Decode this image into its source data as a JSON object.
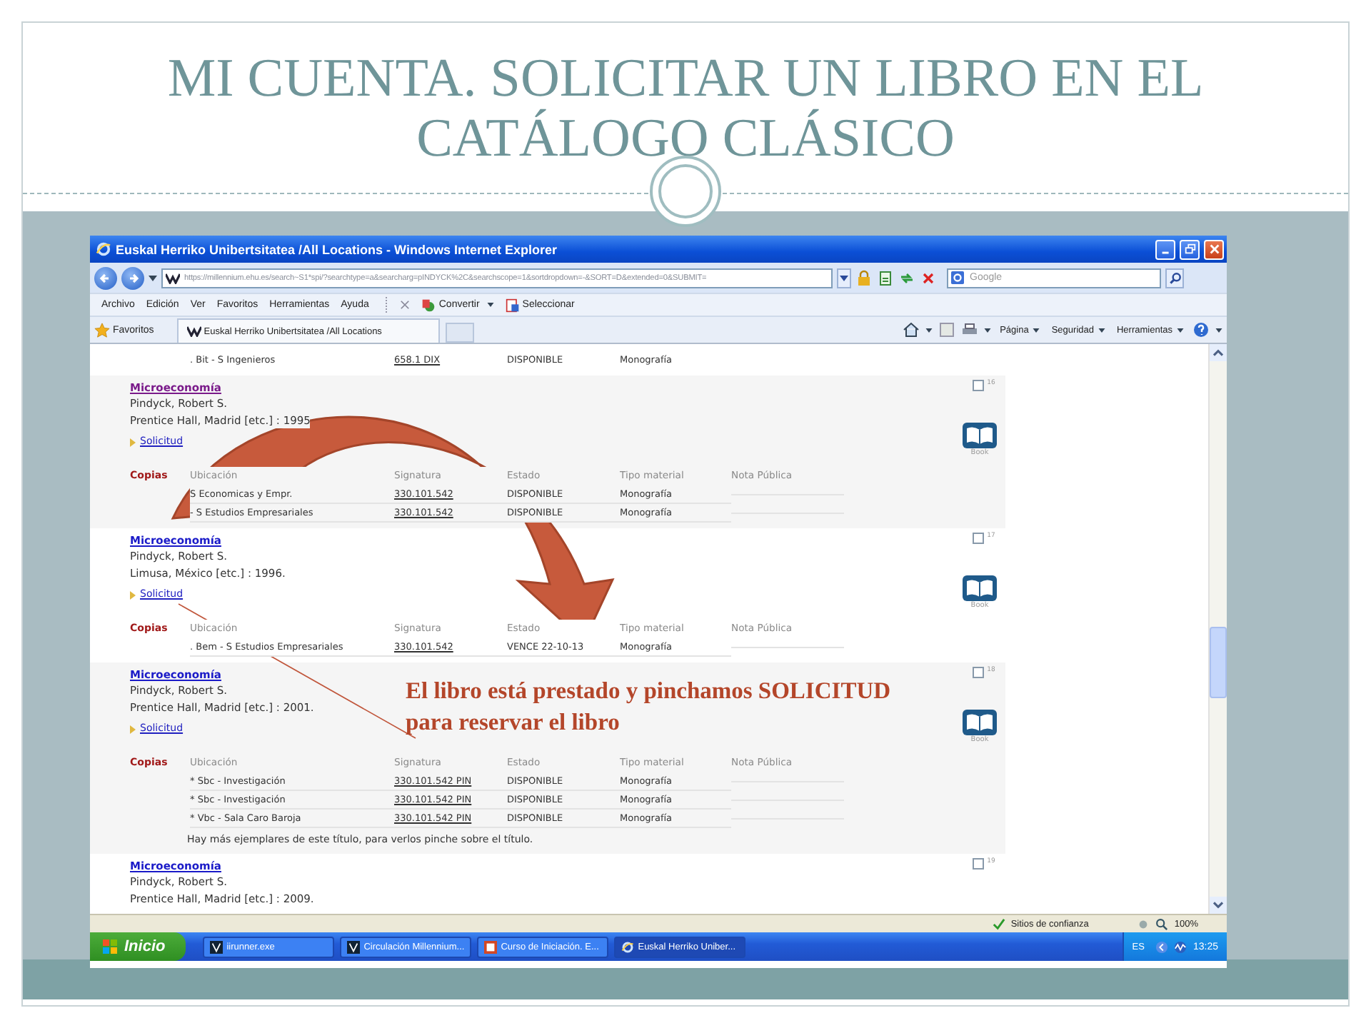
{
  "slide": {
    "title": "MI CUENTA. SOLICITAR UN LIBRO EN EL CATÁLOGO CLÁSICO"
  },
  "browser": {
    "title": "Euskal Herriko Unibertsitatea /All Locations - Windows Internet Explorer",
    "address": "https://millennium.ehu.es/search~S1*spi/?searchtype=a&searcharg=pINDYCK%2C&searchscope=1&sortdropdown=-&SORT=D&extended=0&SUBMIT=",
    "search_placeholder": "Google",
    "menu": [
      "Archivo",
      "Edición",
      "Ver",
      "Favoritos",
      "Herramientas",
      "Ayuda"
    ],
    "toolbar": [
      {
        "label": "Convertir",
        "kind": "convert"
      },
      {
        "label": "Seleccionar",
        "kind": "select"
      }
    ],
    "favorites": "Favoritos",
    "tabs": [
      {
        "label": "Euskal Herriko Unibertsitatea /All Locations",
        "selected": true
      }
    ],
    "commands": [
      "Página",
      "Seguridad",
      "Herramientas"
    ],
    "status": {
      "zone": "Sitios de confianza",
      "zoom": "100%"
    }
  },
  "page": {
    "top_row": {
      "location": ". Bit - S Ingenieros",
      "call_number": "658.1 DIX",
      "status": "DISPONIBLE",
      "material": "Monografía"
    },
    "records": [
      {
        "number": "16",
        "checked": false,
        "title": "Microeconomía",
        "visited": true,
        "author": "Pindyck, Robert S.",
        "publisher": "Prentice Hall, Madrid [etc.] : 1995",
        "request_link": "Solicitud",
        "material_label": "Book",
        "copies": {
          "label": "Copias",
          "columns": [
            "Ubicación",
            "Signatura",
            "Estado",
            "Tipo material",
            "Nota Pública"
          ],
          "rows": [
            {
              "location": "S Economicas y Empr.",
              "call_number": "330.101.542",
              "status": "DISPONIBLE",
              "material": "Monografía"
            },
            {
              "location": "- S Estudios Empresariales",
              "call_number": "330.101.542",
              "status": "DISPONIBLE",
              "material": "Monografía"
            }
          ]
        }
      },
      {
        "number": "17",
        "checked": false,
        "title": "Microeconomía",
        "visited": false,
        "author": "Pindyck, Robert S.",
        "publisher": "Limusa, México [etc.] : 1996.",
        "request_link": "Solicitud",
        "material_label": "Book",
        "copies": {
          "label": "Copias",
          "columns": [
            "Ubicación",
            "Signatura",
            "Estado",
            "Tipo material",
            "Nota Pública"
          ],
          "rows": [
            {
              "location": ". Bem - S Estudios Empresariales",
              "call_number": "330.101.542",
              "status": "VENCE 22-10-13",
              "material": "Monografía"
            }
          ]
        }
      },
      {
        "number": "18",
        "checked": false,
        "title": "Microeconomía",
        "visited": false,
        "author": "Pindyck, Robert S.",
        "publisher": "Prentice Hall, Madrid [etc.] : 2001.",
        "request_link": "Solicitud",
        "material_label": "Book",
        "copies": {
          "label": "Copias",
          "columns": [
            "Ubicación",
            "Signatura",
            "Estado",
            "Tipo material",
            "Nota Pública"
          ],
          "rows": [
            {
              "location": "* Sbc - Investigación",
              "call_number": "330.101.542 PIN",
              "status": "DISPONIBLE",
              "material": "Monografía"
            },
            {
              "location": "* Sbc - Investigación",
              "call_number": "330.101.542 PIN",
              "status": "DISPONIBLE",
              "material": "Monografía"
            },
            {
              "location": "* Vbc - Sala Caro Baroja",
              "call_number": "330.101.542 PIN",
              "status": "DISPONIBLE",
              "material": "Monografía"
            }
          ]
        },
        "note": "Hay más ejemplares de este título, para verlos pinche sobre el título."
      },
      {
        "number": "19",
        "checked": false,
        "title": "Microeconomía",
        "visited": false,
        "author": "Pindyck, Robert S.",
        "publisher": "Prentice Hall, Madrid [etc.] : 2009."
      }
    ]
  },
  "callout": "El libro está prestado y pinchamos SOLICITUD para reservar el libro",
  "taskbar": {
    "start": "Inicio",
    "tasks": [
      {
        "label": "iirunner.exe",
        "kind": "app",
        "selected": false
      },
      {
        "label": "Circulación Millennium...",
        "kind": "app",
        "selected": false
      },
      {
        "label": "Curso de Iniciación. E...",
        "kind": "slides",
        "selected": false
      },
      {
        "label": "Euskal Herriko Uniber...",
        "kind": "browser",
        "selected": true
      }
    ],
    "language": "ES",
    "time": "13:25"
  }
}
